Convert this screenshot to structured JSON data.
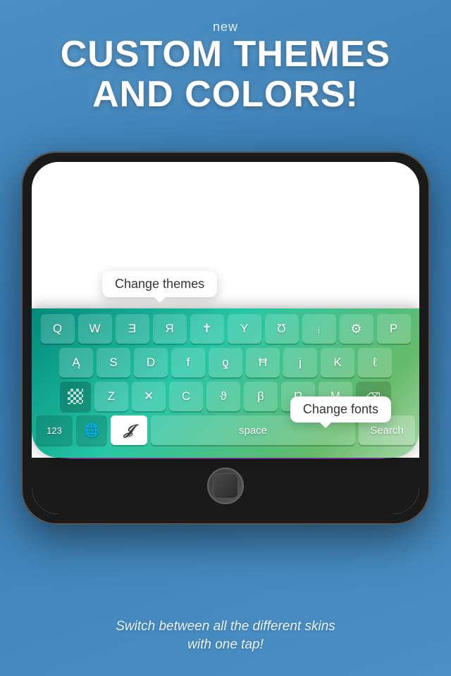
{
  "page": {
    "background_color": "#4a90c4",
    "new_label": "new",
    "main_title_line1": "CUSTOM THEMES",
    "main_title_line2": "AND COLORS!",
    "bottom_text_line1": "Switch between all the different skins",
    "bottom_text_line2": "with one tap!"
  },
  "keyboard": {
    "row1": [
      "Q",
      "W",
      "Ǝ",
      "Я",
      "✝",
      "Y",
      "Ʊ",
      "ᵢ",
      "⚙",
      "P"
    ],
    "row2": [
      "Ą",
      "S",
      "D",
      "f",
      "ƍ",
      "Ħ",
      "j",
      "K",
      "ℓ"
    ],
    "row3": [
      "Z",
      "X",
      "C",
      "ϑ",
      "β",
      "Ŋ",
      "M"
    ],
    "row4_123": "123",
    "row4_globe": "🌐",
    "row4_font": "J",
    "row4_space": "space",
    "row4_search": "Search",
    "backspace": "⌫"
  },
  "tooltips": {
    "change_themes": "Change themes",
    "change_fonts": "Change fonts"
  }
}
